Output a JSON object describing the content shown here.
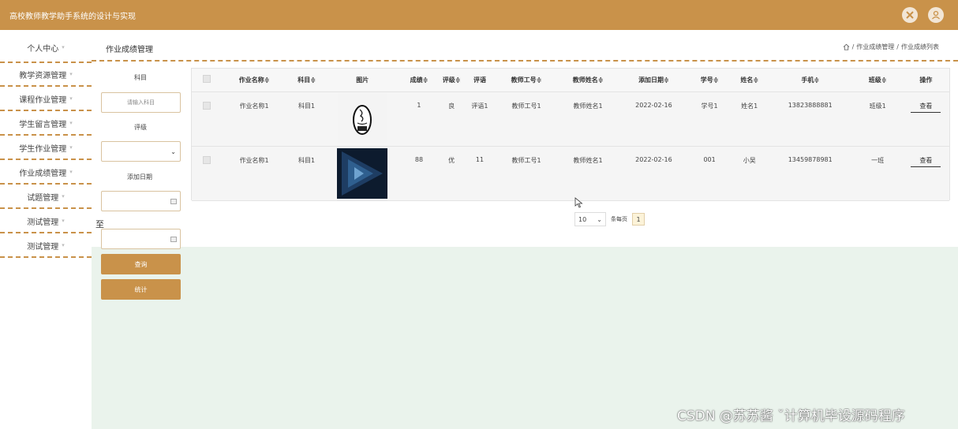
{
  "header": {
    "title": "高校教师教学助手系统的设计与实现",
    "accent_color": "#c9924a"
  },
  "sidebar": {
    "items": [
      {
        "label": "个人中心"
      },
      {
        "label": "教学资源管理"
      },
      {
        "label": "课程作业管理"
      },
      {
        "label": "学生留言管理"
      },
      {
        "label": "学生作业管理"
      },
      {
        "label": "作业成绩管理"
      },
      {
        "label": "试题管理"
      },
      {
        "label": "测试管理"
      },
      {
        "label": "测试管理"
      }
    ]
  },
  "page": {
    "title": "作业成绩管理",
    "breadcrumb": {
      "sep": "/",
      "level1": "作业成绩管理",
      "level2": "作业成绩列表"
    }
  },
  "filters": {
    "subject_label": "科目",
    "subject_placeholder": "请输入科目",
    "grade_label": "评级",
    "date_label": "添加日期",
    "to_label": "至",
    "search_button": "查询",
    "stats_button": "统计"
  },
  "table": {
    "headers": [
      "作业名称≑",
      "科目≑",
      "图片",
      "成绩≑",
      "评级≑",
      "评语",
      "教师工号≑",
      "教师姓名≑",
      "添加日期≑",
      "学号≑",
      "姓名≑",
      "手机≑",
      "班级≑",
      "操作"
    ],
    "rows": [
      {
        "name": "作业名称1",
        "subject": "科目1",
        "image": "java-logo",
        "score": "1",
        "grade": "良",
        "comment": "评语1",
        "teacher_id": "教师工号1",
        "teacher_name": "教师姓名1",
        "date": "2022-02-16",
        "student_id": "学号1",
        "student_name": "姓名1",
        "phone": "13823888881",
        "class": "班级1",
        "action": "查看"
      },
      {
        "name": "作业名称1",
        "subject": "科目1",
        "image": "code-image",
        "score": "88",
        "grade": "优",
        "comment": "11",
        "teacher_id": "教师工号1",
        "teacher_name": "教师姓名1",
        "date": "2022-02-16",
        "student_id": "001",
        "student_name": "小吴",
        "phone": "13459878981",
        "class": "一班",
        "action": "查看"
      }
    ]
  },
  "pagination": {
    "page_size": "10",
    "per_page_label": "条每页",
    "current_page": "1"
  },
  "watermark": "CSDN @苏苏酱   ˇ计算机毕设源码程序"
}
